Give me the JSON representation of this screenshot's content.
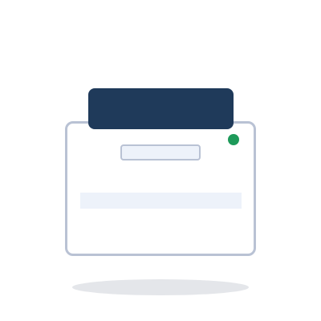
{
  "illustration": {
    "subject": "printer",
    "colors": {
      "panel": "#1f3a5a",
      "outline": "#b9c2d4",
      "body": "#ffffff",
      "slot_fill": "#edf2fa",
      "status_light": "#1e9a5a",
      "shadow": "#e4e6ea"
    },
    "icons": [
      "printer-icon",
      "status-light-icon"
    ]
  }
}
